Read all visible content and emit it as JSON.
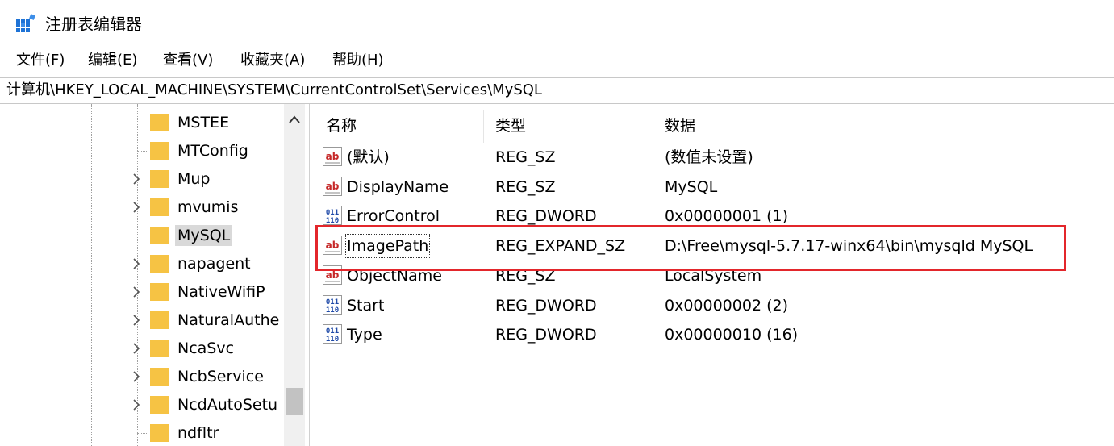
{
  "window": {
    "title": "注册表编辑器",
    "icon": "regedit-app-icon"
  },
  "menu": [
    "文件(F)",
    "编辑(E)",
    "查看(V)",
    "收藏夹(A)",
    "帮助(H)"
  ],
  "address": "计算机\\HKEY_LOCAL_MACHINE\\SYSTEM\\CurrentControlSet\\Services\\MySQL",
  "tree": {
    "items": [
      {
        "label": "MSTEE",
        "expandable": false,
        "selected": false
      },
      {
        "label": "MTConfig",
        "expandable": false,
        "selected": false
      },
      {
        "label": "Mup",
        "expandable": true,
        "selected": false
      },
      {
        "label": "mvumis",
        "expandable": true,
        "selected": false
      },
      {
        "label": "MySQL",
        "expandable": false,
        "selected": true
      },
      {
        "label": "napagent",
        "expandable": true,
        "selected": false
      },
      {
        "label": "NativeWifiP",
        "expandable": true,
        "selected": false
      },
      {
        "label": "NaturalAuthe",
        "expandable": true,
        "selected": false
      },
      {
        "label": "NcaSvc",
        "expandable": true,
        "selected": false
      },
      {
        "label": "NcbService",
        "expandable": true,
        "selected": false
      },
      {
        "label": "NcdAutoSetu",
        "expandable": true,
        "selected": false
      },
      {
        "label": "ndfltr",
        "expandable": false,
        "selected": false
      }
    ]
  },
  "list": {
    "columns": {
      "name": "名称",
      "type": "类型",
      "data": "数据"
    },
    "rows": [
      {
        "icon": "string-value-icon",
        "name": "(默认)",
        "type": "REG_SZ",
        "data": "(数值未设置)",
        "highlighted": false
      },
      {
        "icon": "string-value-icon",
        "name": "DisplayName",
        "type": "REG_SZ",
        "data": "MySQL",
        "highlighted": false
      },
      {
        "icon": "binary-value-icon",
        "name": "ErrorControl",
        "type": "REG_DWORD",
        "data": "0x00000001 (1)",
        "highlighted": false
      },
      {
        "icon": "string-value-icon",
        "name": "ImagePath",
        "type": "REG_EXPAND_SZ",
        "data": "D:\\Free\\mysql-5.7.17-winx64\\bin\\mysqld MySQL",
        "highlighted": true
      },
      {
        "icon": "string-value-icon",
        "name": "ObjectName",
        "type": "REG_SZ",
        "data": "LocalSystem",
        "highlighted": false
      },
      {
        "icon": "binary-value-icon",
        "name": "Start",
        "type": "REG_DWORD",
        "data": "0x00000002 (2)",
        "highlighted": false
      },
      {
        "icon": "binary-value-icon",
        "name": "Type",
        "type": "REG_DWORD",
        "data": "0x00000010 (16)",
        "highlighted": false
      }
    ]
  },
  "colors": {
    "folder": "#f6c344",
    "highlight_box": "#e3262b",
    "selected_bg": "#d9d9d9",
    "string_icon_red": "#c62828",
    "binary_icon_blue": "#1f4aa8"
  }
}
